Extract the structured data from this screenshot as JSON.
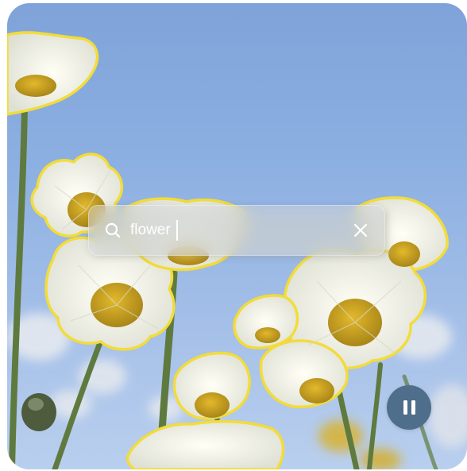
{
  "search": {
    "query": "flower",
    "icon": "search-icon",
    "clear_icon": "close-icon"
  },
  "video": {
    "state_icon": "pause-icon"
  },
  "colors": {
    "highlight_outline": "#f2dc3a",
    "sky": "#8db0e2",
    "control_button": "#4f6e8b",
    "petal": "#f4f4ea",
    "flower_center": "#c9a31f"
  }
}
